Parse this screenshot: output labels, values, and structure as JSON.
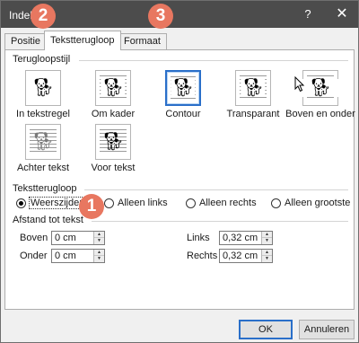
{
  "window": {
    "title": "Indeling",
    "help_label": "?",
    "close_label": "✕"
  },
  "tabs": [
    {
      "label": "Positie",
      "active": false
    },
    {
      "label": "Tekstterugloop",
      "active": true
    },
    {
      "label": "Formaat",
      "active": false
    }
  ],
  "wrapping_style": {
    "title": "Terugloopstijl",
    "options": [
      {
        "label": "In tekstregel",
        "selected": false
      },
      {
        "label": "Om kader",
        "selected": false
      },
      {
        "label": "Contour",
        "selected": true
      },
      {
        "label": "Transparant",
        "selected": false
      },
      {
        "label": "Boven en onder",
        "selected": false
      },
      {
        "label": "Achter tekst",
        "selected": false
      },
      {
        "label": "Voor tekst",
        "selected": false
      }
    ]
  },
  "wrap_text": {
    "title": "Tekstterugloop",
    "options": [
      {
        "label": "Weerszijden",
        "checked": true
      },
      {
        "label": "Alleen links",
        "checked": false
      },
      {
        "label": "Alleen rechts",
        "checked": false
      },
      {
        "label": "Alleen grootste",
        "checked": false
      }
    ]
  },
  "distance": {
    "title": "Afstand tot tekst",
    "top": {
      "label": "Boven",
      "value": "0 cm"
    },
    "bottom": {
      "label": "Onder",
      "value": "0 cm"
    },
    "left": {
      "label": "Links",
      "value": "0,32 cm"
    },
    "right": {
      "label": "Rechts",
      "value": "0,32 cm"
    }
  },
  "buttons": {
    "ok": "OK",
    "cancel": "Annuleren"
  },
  "callouts": {
    "one": "1",
    "two": "2",
    "three": "3"
  },
  "icons": {
    "wrap_icon": "dog-in-text-icon",
    "spin_icon": "spin-arrows-icon"
  },
  "colors": {
    "titlebar": "#4c4c4c",
    "selection": "#2a6fc9",
    "callout": "#e87760"
  }
}
